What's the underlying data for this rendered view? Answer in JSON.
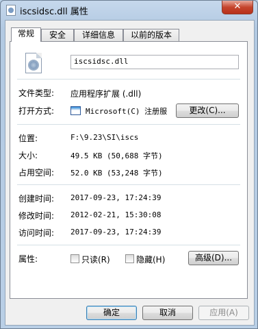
{
  "window": {
    "title": "iscsidsc.dll 属性",
    "close_glyph": "✕"
  },
  "tabs": [
    "常规",
    "安全",
    "详细信息",
    "以前的版本"
  ],
  "general": {
    "file_name": "iscsidsc.dll",
    "file_type_label": "文件类型:",
    "file_type_value": "应用程序扩展 (.dll)",
    "opens_with_label": "打开方式:",
    "opens_with_value": "Microsoft(C) 注册服",
    "change_button": "更改(C)...",
    "location_label": "位置:",
    "location_value": "F:\\9.23\\SI\\iscs",
    "size_label": "大小:",
    "size_value": "49.5 KB (50,688 字节)",
    "size_on_disk_label": "占用空间:",
    "size_on_disk_value": "52.0 KB (53,248 字节)",
    "created_label": "创建时间:",
    "created_value": "2017-09-23, 17:24:39",
    "modified_label": "修改时间:",
    "modified_value": "2012-02-21, 15:30:08",
    "accessed_label": "访问时间:",
    "accessed_value": "2017-09-23, 17:24:39",
    "attributes_label": "属性:",
    "readonly_label": "只读(R)",
    "hidden_label": "隐藏(H)",
    "advanced_button": "高级(D)..."
  },
  "footer": {
    "ok": "确定",
    "cancel": "取消",
    "apply": "应用(A)"
  }
}
